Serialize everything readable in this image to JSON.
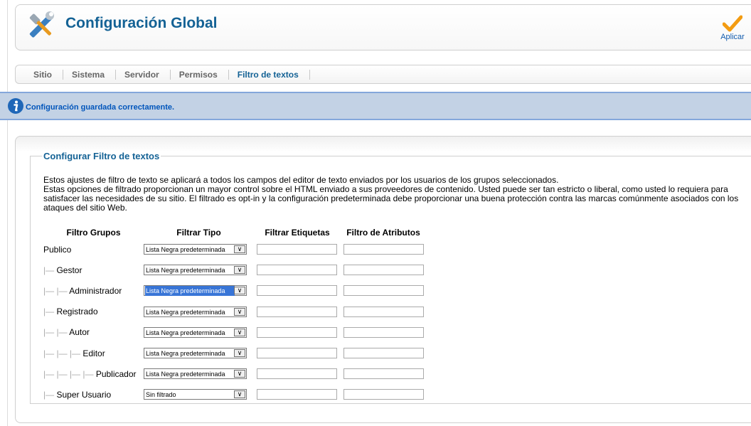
{
  "header": {
    "title": "Configuración Global",
    "apply_label": "Aplicar"
  },
  "tabs": [
    {
      "label": "Sitio"
    },
    {
      "label": "Sistema"
    },
    {
      "label": "Servidor"
    },
    {
      "label": "Permisos"
    },
    {
      "label": "Filtro de textos",
      "active": true
    }
  ],
  "message": {
    "text": "Configuración guardada correctamente."
  },
  "section": {
    "legend": "Configurar Filtro de textos",
    "desc1": "Estos ajustes de filtro de texto se aplicará a todos los campos del editor de texto enviados por los usuarios de los grupos seleccionados.",
    "desc2": "Estas opciones de filtrado proporcionan un mayor control sobre el HTML enviado a sus proveedores de contenido. Usted puede ser tan estricto o liberal, como usted lo requiera para satisfacer las necesidades de su sitio. El filtrado es opt-in y la configuración predeterminada debe proporcionar una buena protección contra las marcas comúnmente asociados con los ataques del sitio Web."
  },
  "table": {
    "headers": [
      "Filtro Grupos",
      "Filtrar Tipo",
      "Filtrar Etiquetas",
      "Filtro de Atributos"
    ],
    "rows": [
      {
        "prefix": "",
        "group": "Publico",
        "type": "Lista Negra predeterminada",
        "tags": "",
        "attrs": ""
      },
      {
        "prefix": "|—",
        "group": "Gestor",
        "type": "Lista Negra predeterminada",
        "tags": "",
        "attrs": ""
      },
      {
        "prefix": "|— |—",
        "group": "Administrador",
        "type": "Lista Negra predeterminada",
        "tags": "",
        "attrs": "",
        "highlighted": true
      },
      {
        "prefix": "|—",
        "group": "Registrado",
        "type": "Lista Negra predeterminada",
        "tags": "",
        "attrs": ""
      },
      {
        "prefix": "|— |—",
        "group": "Autor",
        "type": "Lista Negra predeterminada",
        "tags": "",
        "attrs": ""
      },
      {
        "prefix": "|— |— |—",
        "group": "Editor",
        "type": "Lista Negra predeterminada",
        "tags": "",
        "attrs": ""
      },
      {
        "prefix": "|— |— |— |—",
        "group": "Publicador",
        "type": "Lista Negra predeterminada",
        "tags": "",
        "attrs": ""
      },
      {
        "prefix": "|—",
        "group": "Super Usuario",
        "type": "Sin filtrado",
        "tags": "",
        "attrs": ""
      }
    ]
  },
  "icons": {
    "tools": "tools-icon",
    "apply": "checkmark-icon",
    "info": "info-icon",
    "dropdown": "chevron-down-icon"
  },
  "colors": {
    "title": "#146295",
    "message_bg": "#c3d2e5",
    "message_border": "#84a7db",
    "message_text": "#0055bb",
    "selection": "#3875d7"
  }
}
